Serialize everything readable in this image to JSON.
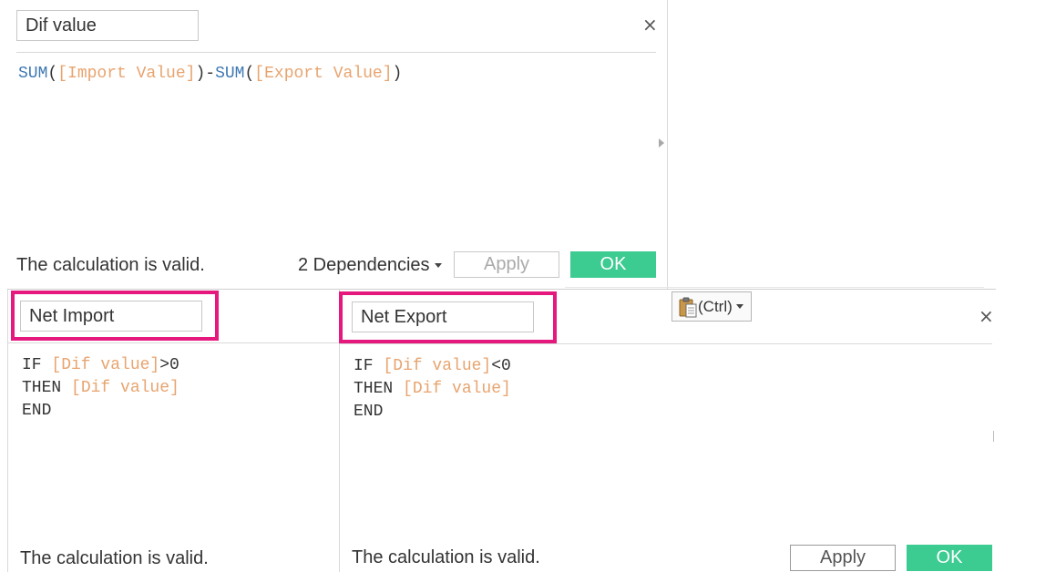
{
  "top": {
    "calc_name": "Dif value",
    "formula": {
      "fn1": "SUM",
      "open1": "(",
      "field1": "[Import Value]",
      "close1": ")",
      "minus": "-",
      "fn2": "SUM",
      "open2": "(",
      "field2": "[Export Value]",
      "close2": ")"
    },
    "status": "The calculation is valid.",
    "dependencies_label": "2 Dependencies",
    "apply_label": "Apply",
    "ok_label": "OK"
  },
  "left": {
    "calc_name": "Net Import",
    "line1_kw": "IF ",
    "line1_field": "[Dif value]",
    "line1_op": ">0",
    "line2_kw": "THEN ",
    "line2_field": "[Dif value]",
    "line3_kw": "END",
    "status": "The calculation is valid."
  },
  "right": {
    "calc_name": "Net Export",
    "line1_kw": "IF ",
    "line1_field": "[Dif value]",
    "line1_op": "<0",
    "line2_kw": "THEN ",
    "line2_field": "[Dif value]",
    "line3_kw": "END",
    "status": "The calculation is valid.",
    "apply_label": "Apply",
    "ok_label": "OK"
  },
  "paste_options": {
    "label": "(Ctrl)",
    "icon": "clipboard-icon"
  },
  "close_glyph": "×",
  "colors": {
    "function": "#3f79b3",
    "field": "#e8a46f",
    "ok_button": "#3ccb91",
    "highlight": "#e5187d"
  }
}
